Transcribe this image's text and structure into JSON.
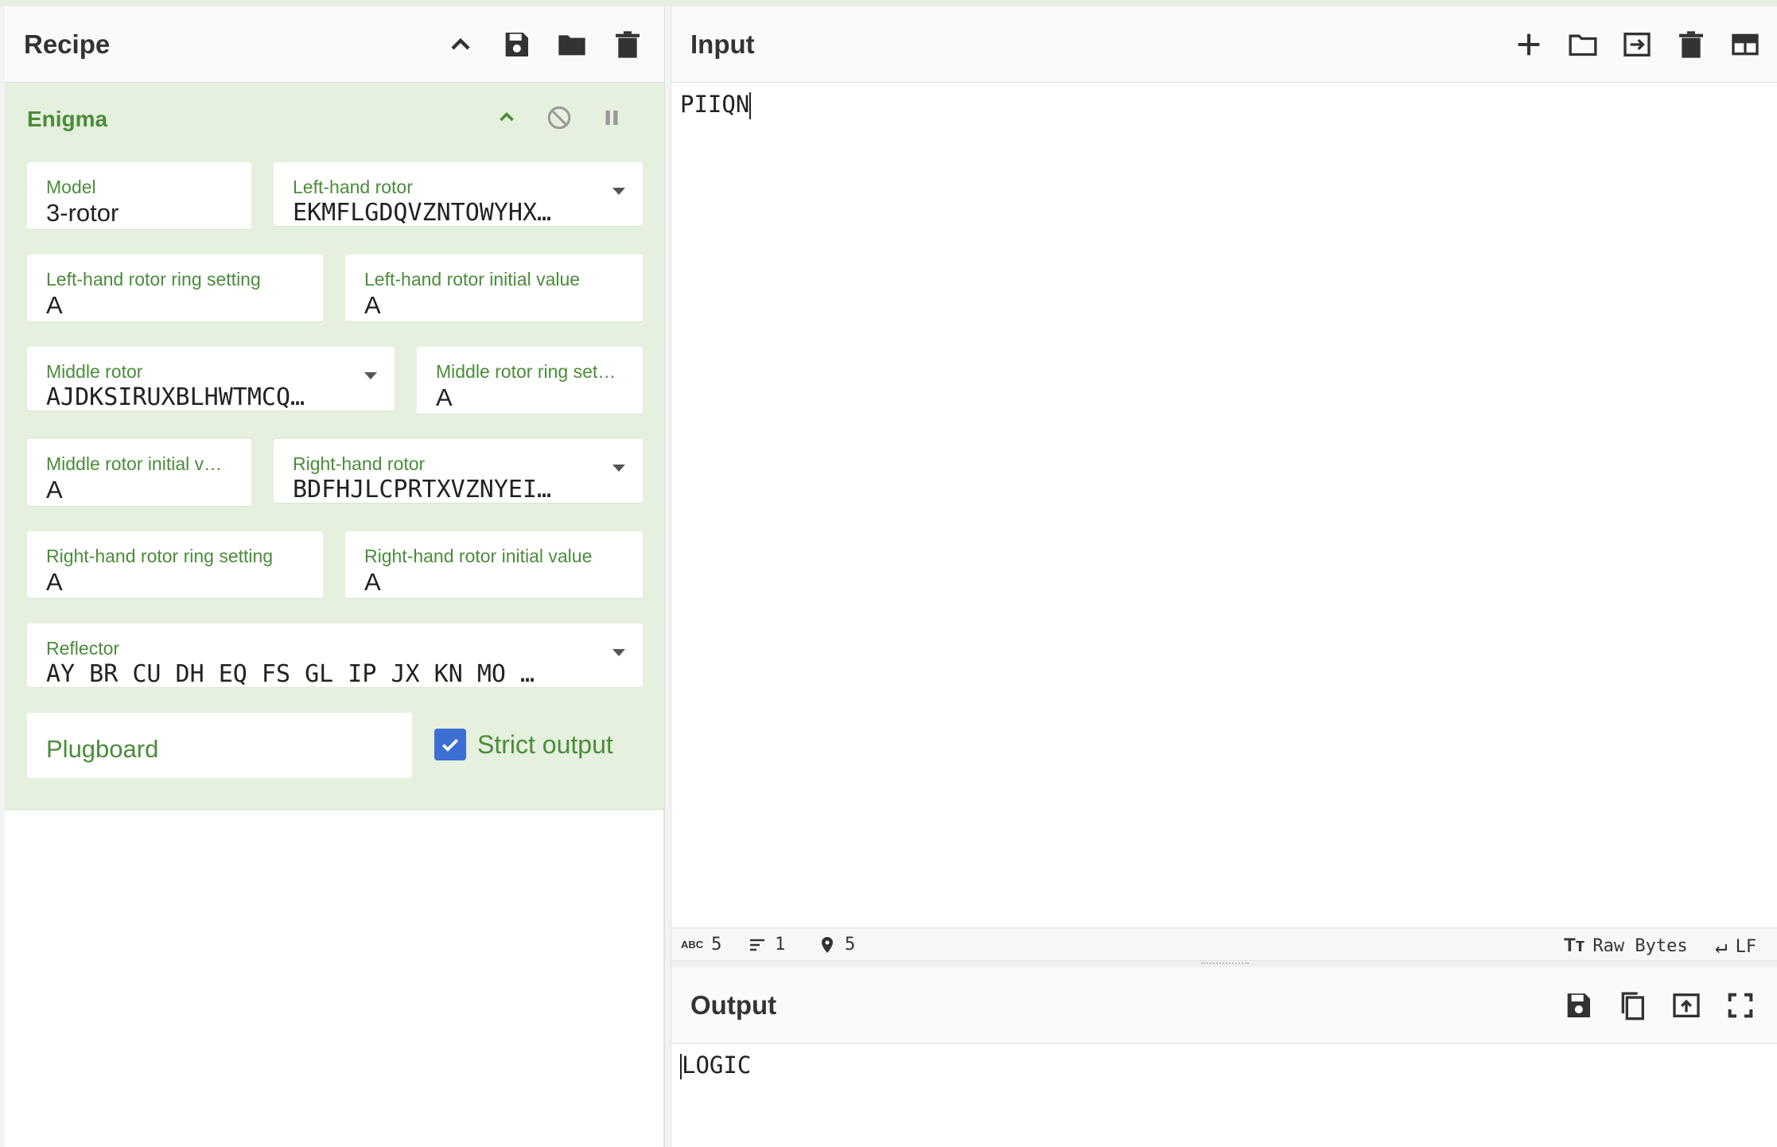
{
  "recipe": {
    "title": "Recipe",
    "icons": [
      "chevron-up-icon",
      "save-icon",
      "folder-icon",
      "trash-icon"
    ]
  },
  "operation": {
    "name": "Enigma",
    "icons": [
      "chevron-up-icon",
      "disable-icon",
      "pause-icon"
    ],
    "fields": {
      "model": {
        "label": "Model",
        "value": "3-rotor"
      },
      "left_rotor": {
        "label": "Left-hand rotor",
        "value": "EKMFLGDQVZNTOWYHX…"
      },
      "left_ring": {
        "label": "Left-hand rotor ring setting",
        "value": "A"
      },
      "left_initial": {
        "label": "Left-hand rotor initial value",
        "value": "A"
      },
      "middle_rotor": {
        "label": "Middle rotor",
        "value": "AJDKSIRUXBLHWTMCQ…"
      },
      "middle_ring": {
        "label": "Middle rotor ring set…",
        "value": "A"
      },
      "middle_initial": {
        "label": "Middle rotor initial v…",
        "value": "A"
      },
      "right_rotor": {
        "label": "Right-hand rotor",
        "value": "BDFHJLCPRTXVZNYEI…"
      },
      "right_ring": {
        "label": "Right-hand rotor ring setting",
        "value": "A"
      },
      "right_initial": {
        "label": "Right-hand rotor initial value",
        "value": "A"
      },
      "reflector": {
        "label": "Reflector",
        "value": "AY BR CU DH EQ FS GL IP JX KN MO …"
      },
      "plugboard": {
        "label": "Plugboard"
      },
      "strict_output": {
        "label": "Strict output",
        "checked": true
      }
    }
  },
  "input": {
    "title": "Input",
    "text": "PIIQN",
    "icons": [
      "plus-icon",
      "open-folder-icon",
      "import-icon",
      "trash-icon",
      "layout-icon"
    ],
    "status": {
      "chars": "5",
      "lines": "1",
      "position": "5",
      "encoding": "Raw Bytes",
      "eol": "LF"
    }
  },
  "output": {
    "title": "Output",
    "text": "LOGIC",
    "icons": [
      "save-icon",
      "copy-icon",
      "replace-input-icon",
      "fullscreen-icon"
    ]
  },
  "colors": {
    "accent_green": "#4a8c3a",
    "op_background": "#e6f0de",
    "checkbox_blue": "#3b6fd4"
  }
}
